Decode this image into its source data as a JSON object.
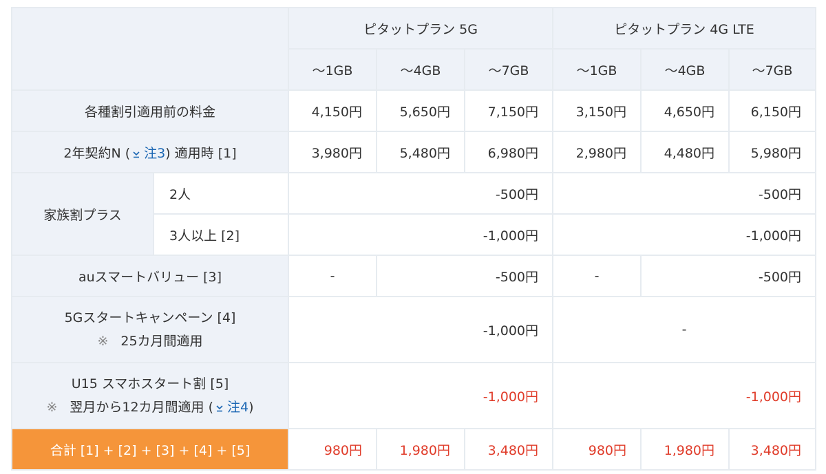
{
  "header": {
    "plan_5g": "ピタットプラン 5G",
    "plan_4g": "ピタットプラン 4G LTE",
    "tiers_5g": [
      "〜1GB",
      "〜4GB",
      "〜7GB"
    ],
    "tiers_4g": [
      "〜1GB",
      "〜4GB",
      "〜7GB"
    ]
  },
  "rows": {
    "base": {
      "label": "各種割引適用前の料金",
      "values_5g": [
        "4,150円",
        "5,650円",
        "7,150円"
      ],
      "values_4g": [
        "3,150円",
        "4,650円",
        "6,150円"
      ]
    },
    "contract": {
      "label_pre": "2年契約N (",
      "note_link": "注3",
      "label_post": ") 適用時 [1]",
      "values_5g": [
        "3,980円",
        "5,480円",
        "6,980円"
      ],
      "values_4g": [
        "2,980円",
        "4,480円",
        "5,980円"
      ]
    },
    "family": {
      "label": "家族割プラス",
      "sub1_label": "2人",
      "sub1_value_5g": "-500円",
      "sub1_value_4g": "-500円",
      "sub2_label": "3人以上 [2]",
      "sub2_value_5g": "-1,000円",
      "sub2_value_4g": "-1,000円"
    },
    "smartvalue": {
      "label": "auスマートバリュー [3]",
      "value_5g_1gb": "-",
      "value_5g_rest": "-500円",
      "value_4g_1gb": "-",
      "value_4g_rest": "-500円"
    },
    "campaign5g": {
      "label_line1": "5Gスタートキャンペーン [4]",
      "mark": "※",
      "label_line2": "25カ月間適用",
      "value_5g": "-1,000円",
      "value_4g": "-"
    },
    "u15": {
      "label_line1": "U15 スマホスタート割 [5]",
      "mark": "※",
      "label_line2_pre": "翌月から12カ月間適用 (",
      "note_link": "注4",
      "label_line2_post": ")",
      "value_5g": "-1,000円",
      "value_4g": "-1,000円"
    },
    "total": {
      "label": "合計 [1] + [2] + [3] + [4] + [5]",
      "values_5g": [
        "980円",
        "1,980円",
        "3,480円"
      ],
      "values_4g": [
        "980円",
        "1,980円",
        "3,480円"
      ]
    }
  },
  "colors": {
    "header_bg": "#eef2f8",
    "border": "#e6ebf0",
    "total_bg": "#f5953a",
    "discount_red": "#e03c2a",
    "link_blue": "#1a66b3"
  },
  "icons": {
    "note": "download-arrow-icon"
  }
}
